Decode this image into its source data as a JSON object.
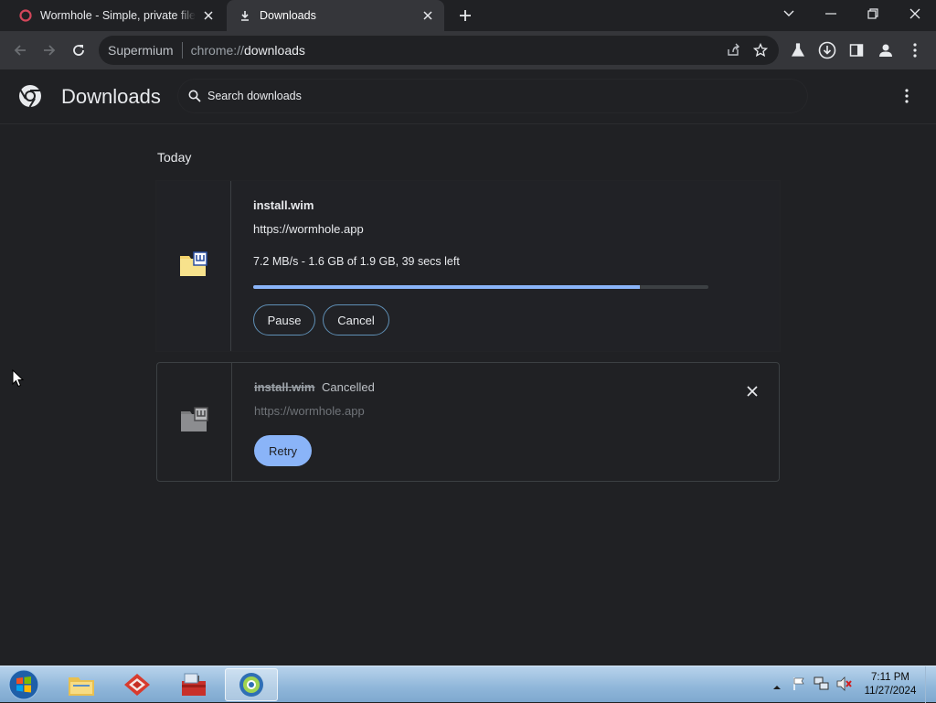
{
  "browser": {
    "tabs": [
      {
        "title": "Wormhole - Simple, private file s",
        "active": false,
        "icon": "wormhole-icon"
      },
      {
        "title": "Downloads",
        "active": true,
        "icon": "download-icon"
      }
    ],
    "omnibox": {
      "site": "Supermium",
      "scheme": "chrome://",
      "path": "downloads"
    }
  },
  "page": {
    "title": "Downloads",
    "search_placeholder": "Search downloads",
    "section": "Today"
  },
  "downloads": [
    {
      "filename": "install.wim",
      "url": "https://wormhole.app",
      "status": "7.2 MB/s - 1.6 GB of 1.9 GB, 39 secs left",
      "progress": 0.85,
      "actions": [
        "Pause",
        "Cancel"
      ]
    },
    {
      "filename": "install.wim",
      "state": "Cancelled",
      "url": "https://wormhole.app",
      "actions": [
        "Retry"
      ]
    }
  ],
  "taskbar": {
    "time": "7:11 PM",
    "date": "11/27/2024"
  },
  "colors": {
    "accent": "#8ab4f8",
    "background": "#202124",
    "toolbar": "#35363a"
  }
}
